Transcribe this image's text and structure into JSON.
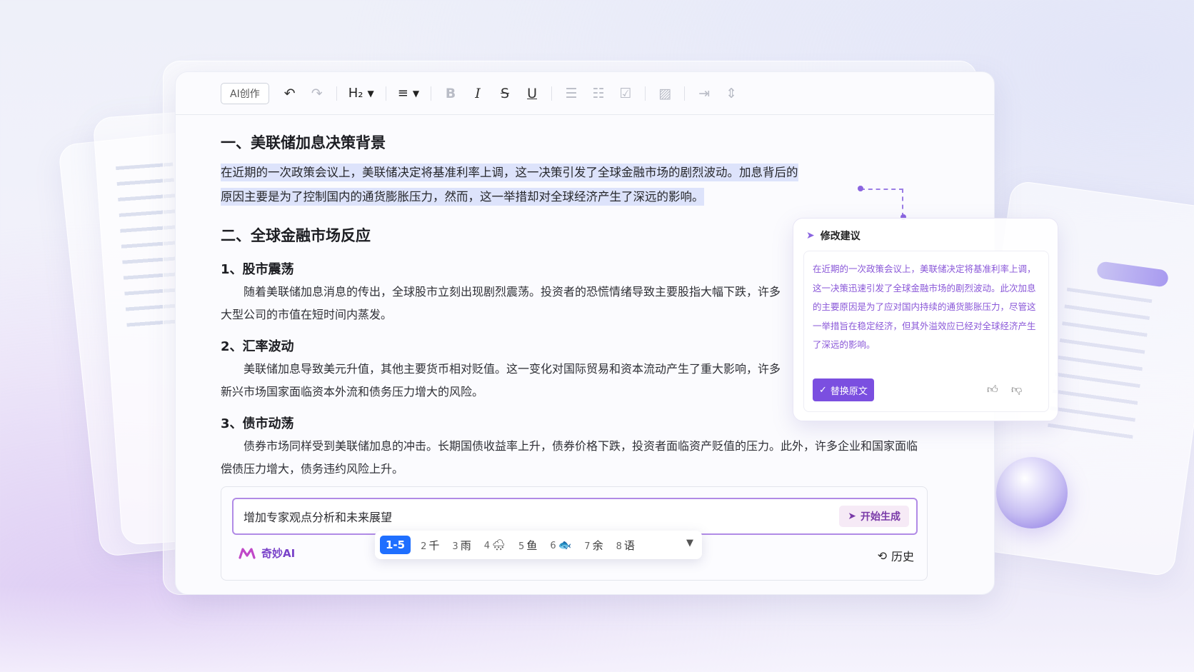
{
  "toolbar": {
    "ai_create_label": "AI创作",
    "heading_label": "H₂",
    "icons": [
      "undo-icon",
      "redo-icon",
      "heading-icon",
      "align-icon",
      "bold-icon",
      "italic-icon",
      "strikethrough-icon",
      "underline-icon",
      "bullet-list-icon",
      "numbered-list-icon",
      "checkbox-icon",
      "image-icon",
      "indent-icon",
      "divider-icon"
    ]
  },
  "document": {
    "heading1": "一、美联储加息决策背景",
    "selected_para_line1": "在近期的一次政策会议上，美联储决定将基准利率上调，这一决策引发了全球金融市场的剧烈波动。加息背后的",
    "selected_para_line2": "原因主要是为了控制国内的通货膨胀压力，然而，这一举措却对全球经济产生了深远的影响。",
    "heading2": "二、全球金融市场反应",
    "sections": [
      {
        "title": "1、股市震荡",
        "text": "随着美联储加息消息的传出，全球股市立刻出现剧烈震荡。投资者的恐慌情绪导致主要股指大幅下跌，许多大型公司的市值在短时间内蒸发。"
      },
      {
        "title": "2、汇率波动",
        "text": "美联储加息导致美元升值，其他主要货币相对贬值。这一变化对国际贸易和资本流动产生了重大影响，许多新兴市场国家面临资本外流和债务压力增大的风险。"
      },
      {
        "title": "3、债市动荡",
        "text": "债券市场同样受到美联储加息的冲击。长期国债收益率上升，债券价格下跌，投资者面临资产贬值的压力。此外，许多企业和国家面临偿债压力增大，债务违约风险上升。"
      }
    ]
  },
  "prompt": {
    "value": "增加专家观点分析和未来展望",
    "generate_label": "开始生成",
    "brand_label": "奇妙AI",
    "history_label": "历史"
  },
  "ime": {
    "selected": "1-5",
    "candidates": [
      {
        "num": "2",
        "text": "千"
      },
      {
        "num": "3",
        "text": "雨"
      },
      {
        "num": "4",
        "text": "🌨"
      },
      {
        "num": "5",
        "text": "鱼"
      },
      {
        "num": "6",
        "text": "🐟"
      },
      {
        "num": "7",
        "text": "余"
      },
      {
        "num": "8",
        "text": "语"
      }
    ]
  },
  "suggestion": {
    "title": "修改建议",
    "text": "在近期的一次政策会议上，美联储决定将基准利率上调，这一决策迅速引发了全球金融市场的剧烈波动。此次加息的主要原因是为了应对国内持续的通货膨胀压力，尽管这一举措旨在稳定经济，但其外溢效应已经对全球经济产生了深远的影响。",
    "replace_label": "替换原文"
  },
  "colors": {
    "accent": "#7b4fe0",
    "selection": "#dde3fb",
    "ime_selected": "#1f6fff"
  }
}
